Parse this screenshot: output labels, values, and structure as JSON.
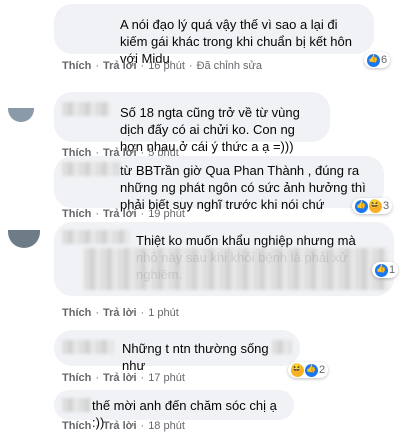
{
  "labels": {
    "like": "Thích",
    "reply": "Trả lời",
    "edited": "Đã chỉnh sửa"
  },
  "comments": [
    {
      "text": "A nói đạo lý quá vậy thế vì sao a lại đi kiếm gái khác trong khi chuẩn bị kết hôn với Midu",
      "time": "16 phút",
      "edited": true,
      "reactions": {
        "types": [
          "like"
        ],
        "count": "6"
      }
    },
    {
      "text": "Số 18 ngta cũng trở về từ vùng dịch đấy có ai chửi ko. Con ng hơn nhau ở cái ý thức a ạ =)))",
      "time": "5 phút"
    },
    {
      "text": "từ BBTrần giờ Qua Phan Thành , đúng ra những ng phát ngôn có sức ảnh hưởng thì phải biết suy nghĩ trước khi nói chứ",
      "time": "19 phút",
      "reactions": {
        "types": [
          "like",
          "haha"
        ],
        "count": "3"
      }
    },
    {
      "text": "Thiệt ko muốn khẩu nghiệp nhưng mà nhỏ này sau khi khỏi bệnh là phải xử nghiêm.",
      "time": "1 phút",
      "reactions": {
        "types": [
          "like"
        ],
        "count": "1"
      }
    },
    {
      "text": "Những t ntn thường sống như",
      "time": "17 phút",
      "reactions": {
        "types": [
          "haha",
          "like"
        ],
        "count": "2"
      }
    },
    {
      "text": "thế mời anh đến chăm sóc chị ạ :))",
      "time": "18 phút"
    }
  ]
}
